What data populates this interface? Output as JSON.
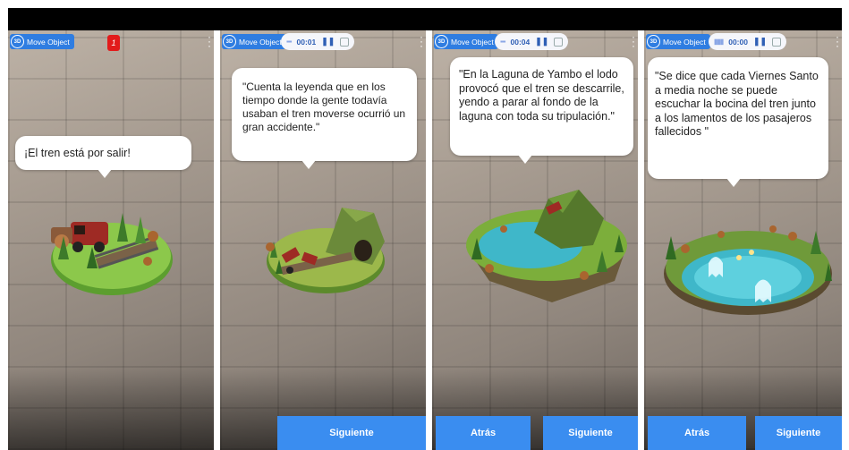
{
  "common": {
    "move_object_label": "Move Object",
    "ar_badge": "3D"
  },
  "panels": [
    {
      "notification_count": "1",
      "bubble_text": "¡El tren está por salir!"
    },
    {
      "timer": "00:01",
      "bubble_text": "\"Cuenta la leyenda que en los tiempo donde la gente todavía usaban el tren moverse ocurrió un gran accidente.\"",
      "next_label": "Siguiente"
    },
    {
      "timer": "00:04",
      "bubble_text": "\"En la Laguna de Yambo el lodo provocó que el tren se descarrile, yendo a parar al fondo de la laguna con toda su tripulación.\"",
      "back_label": "Atrás",
      "next_label": "Siguiente"
    },
    {
      "timer": "00:00",
      "bubble_text": "\"Se dice que cada Viernes Santo a media noche se puede escuchar la bocina del tren junto a los lamentos de los pasajeros fallecidos \"",
      "back_label": "Atrás",
      "next_label": "Siguiente"
    }
  ],
  "colors": {
    "accent": "#3a8df0",
    "notification": "#e21b1b",
    "lagoon": "#3fb7c9",
    "grass": "#8cc84b"
  }
}
